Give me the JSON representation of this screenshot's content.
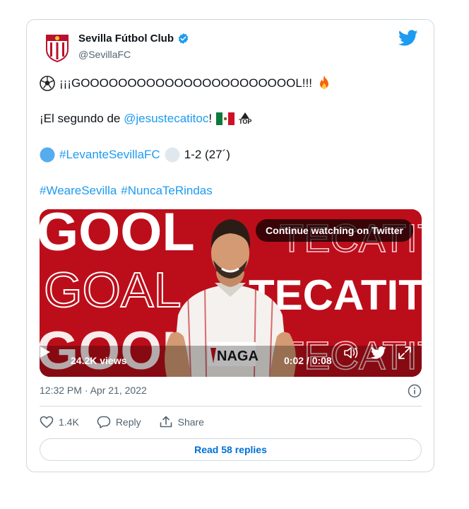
{
  "account": {
    "name": "Sevilla Fútbol Club",
    "handle": "@SevillaFC"
  },
  "tweet": {
    "goal_text": "¡¡¡GOOOOOOOOOOOOOOOOOOOOOOOL!!!",
    "second_prefix": "¡El segundo de ",
    "mention": "@jesustecatitoc",
    "second_suffix": "!",
    "top_label": "TOP",
    "match_hashtag": "#LevanteSevillaFC",
    "score": "1-2 (27´)",
    "hashtag_1": "#WeareSevilla",
    "hashtag_2": "#NuncaTeRindas"
  },
  "media": {
    "bg_words": [
      "GOOL",
      "GOAL",
      "GOOL",
      "TECATITO",
      "TECATITO",
      "TECATITO"
    ],
    "sponsor": "NAGA",
    "continue_label": "Continue watching on Twitter",
    "views": "24.2K views",
    "time": "0:02 / 0:08"
  },
  "meta": {
    "timestamp": "12:32 PM · Apr 21, 2022"
  },
  "actions": {
    "likes": "1.4K",
    "reply": "Reply",
    "share": "Share",
    "read_replies": "Read 58 replies"
  },
  "colors": {
    "link": "#1d9bf0",
    "media_red": "#c6101c"
  }
}
